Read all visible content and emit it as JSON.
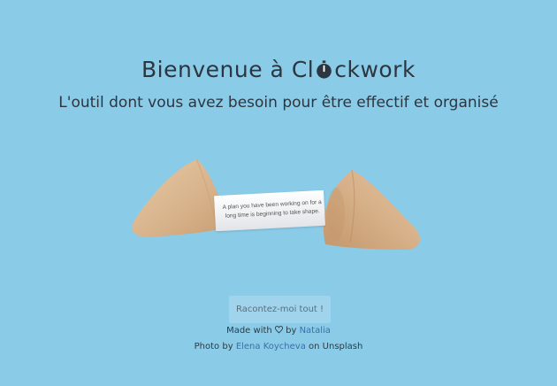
{
  "header": {
    "title_before": "Bienvenue à Cl",
    "title_after": "ckwork",
    "subtitle": "L'outil dont vous avez besoin pour être effectif et organisé"
  },
  "fortune": {
    "line1": "A plan you have been working on for a",
    "line2": "long time is beginning to take shape."
  },
  "cta": {
    "label": "Racontez-moi tout !"
  },
  "footer": {
    "made_with": "Made with",
    "by": "by",
    "author": "Natalia",
    "photo_by": "Photo by",
    "photographer": "Elena Koycheva",
    "on": "on Unsplash"
  },
  "icons": {
    "title_o": "stopwatch-icon",
    "made_with": "heart-icon"
  },
  "colors": {
    "background": "#8acbe8",
    "text": "#2c3640",
    "link": "#3b6fa8"
  }
}
